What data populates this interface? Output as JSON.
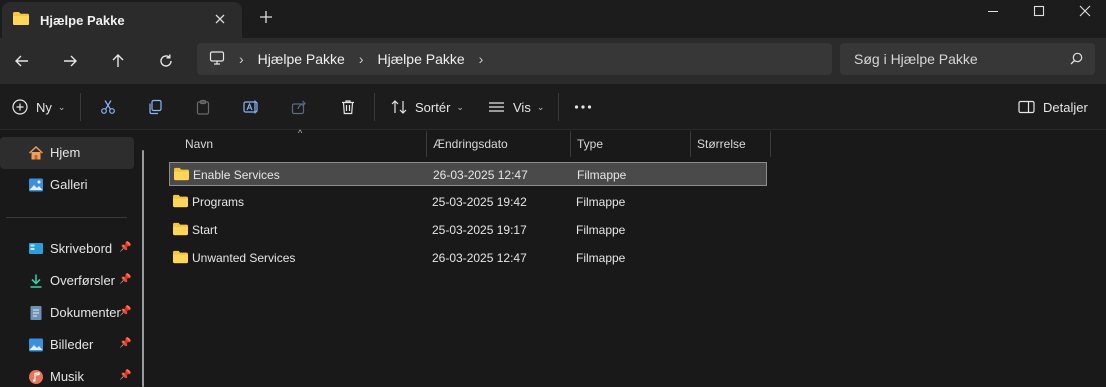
{
  "tab": {
    "title": "Hjælpe Pakke",
    "close_icon": "close-icon",
    "new_tab_icon": "plus-icon"
  },
  "window_controls": {
    "minimize_icon": "minimize-icon",
    "maximize_icon": "maximize-icon",
    "close_icon": "close-icon"
  },
  "nav": {
    "back_icon": "arrow-left-icon",
    "forward_icon": "arrow-right-icon",
    "up_icon": "arrow-up-icon",
    "refresh_icon": "refresh-icon",
    "breadcrumb": [
      "Hjælpe Pakke",
      "Hjælpe Pakke"
    ],
    "search_placeholder": "Søg i Hjælpe Pakke"
  },
  "toolbar": {
    "new_label": "Ny",
    "sort_label": "Sortér",
    "view_label": "Vis",
    "details_label": "Detaljer"
  },
  "sidebar": {
    "items": [
      {
        "label": "Hjem",
        "icon": "home-icon",
        "pinned": false
      },
      {
        "label": "Galleri",
        "icon": "gallery-icon",
        "pinned": false
      },
      {
        "label": "Skrivebord",
        "icon": "desktop-icon",
        "pinned": true
      },
      {
        "label": "Overførsler",
        "icon": "download-icon",
        "pinned": true
      },
      {
        "label": "Dokumenter",
        "icon": "documents-icon",
        "pinned": true
      },
      {
        "label": "Billeder",
        "icon": "pictures-icon",
        "pinned": true
      },
      {
        "label": "Musik",
        "icon": "music-icon",
        "pinned": true
      }
    ]
  },
  "columns": {
    "name": "Navn",
    "modified": "Ændringsdato",
    "type": "Type",
    "size": "Størrelse"
  },
  "files": [
    {
      "name": "Enable Services",
      "modified": "26-03-2025 12:47",
      "type": "Filmappe",
      "size": ""
    },
    {
      "name": "Programs",
      "modified": "25-03-2025 19:42",
      "type": "Filmappe",
      "size": ""
    },
    {
      "name": "Start",
      "modified": "25-03-2025 19:17",
      "type": "Filmappe",
      "size": ""
    },
    {
      "name": "Unwanted Services",
      "modified": "26-03-2025 12:47",
      "type": "Filmappe",
      "size": ""
    }
  ],
  "colors": {
    "folder": "#f5c440",
    "background": "#191919",
    "selected_row": "#4a4a4a"
  }
}
